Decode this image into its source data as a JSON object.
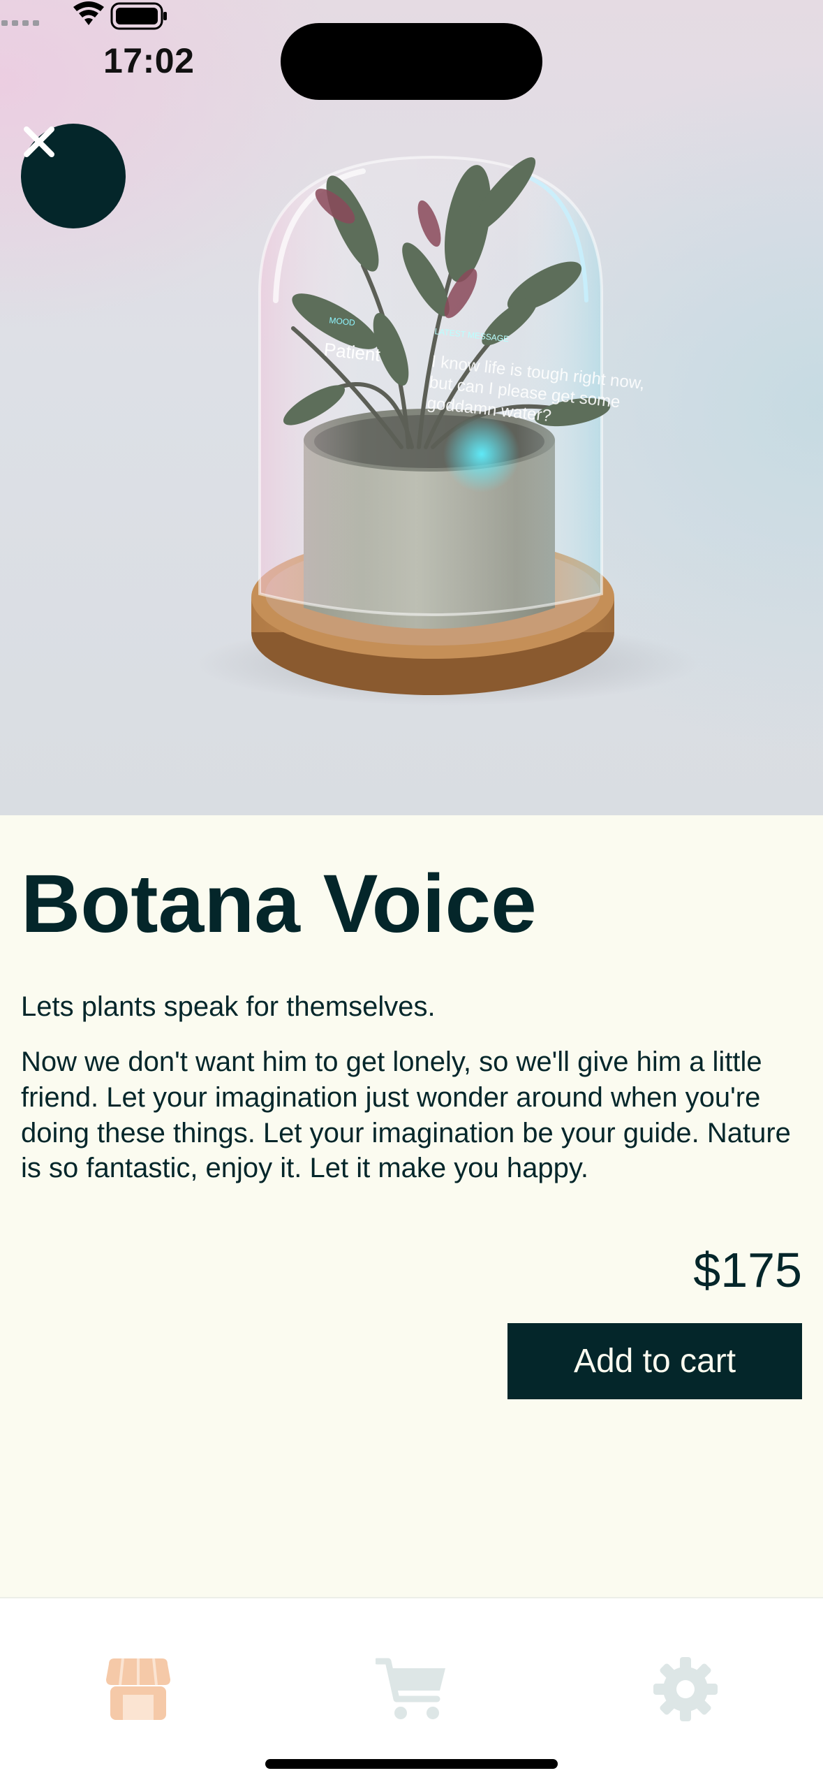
{
  "status_bar": {
    "time": "17:02"
  },
  "hero": {
    "image_alt": "Plant in glass dome with holographic display",
    "overlay_mood_label": "MOOD",
    "overlay_mood_value": "Patient",
    "overlay_message_label": "LATEST MESSAGE",
    "overlay_message_text": "I know life is tough right now, but can I please get some goddamn water?"
  },
  "product": {
    "title": "Botana Voice",
    "tagline": "Lets plants speak for themselves.",
    "description": "Now we don't want him to get lonely, so we'll give him a little friend. Let your imagination just wonder around when you're doing these things. Let your imagination be your guide. Nature is so fantastic, enjoy it. Let it make you happy.",
    "price": "$175",
    "add_to_cart_label": "Add to cart"
  },
  "tab_bar": {
    "items": [
      {
        "icon": "store-icon",
        "active": true
      },
      {
        "icon": "cart-icon",
        "active": false
      },
      {
        "icon": "gear-icon",
        "active": false
      }
    ]
  },
  "colors": {
    "primary": "#04262a",
    "background": "#fbfbf0",
    "tab_active": "#f5c9a8",
    "tab_inactive": "#dde6e6"
  }
}
